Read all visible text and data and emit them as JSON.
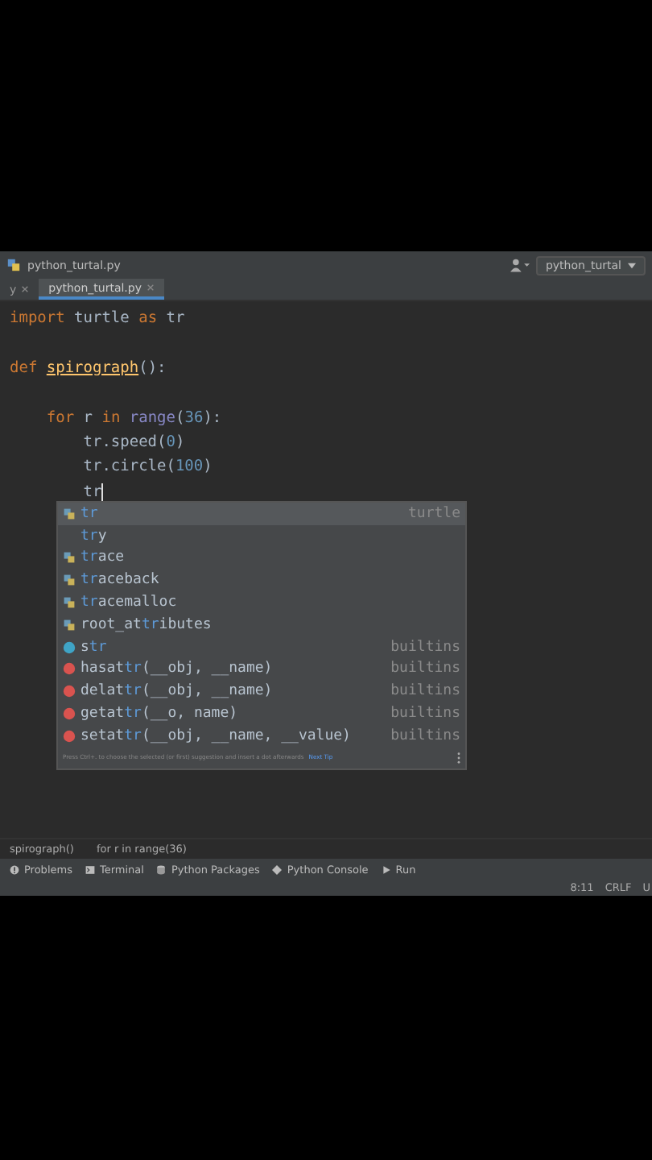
{
  "title_bar": {
    "file": "python_turtal.py",
    "run_config": "python_turtal"
  },
  "tabs": [
    {
      "label": "y",
      "selected": false
    },
    {
      "label": "python_turtal.py",
      "selected": true
    }
  ],
  "code_lines": [
    {
      "kind": "code",
      "tokens": [
        {
          "kind": "keyword",
          "text": "import"
        },
        {
          "kind": "plain",
          "text": " turtle "
        },
        {
          "kind": "keyword",
          "text": "as"
        },
        {
          "kind": "plain",
          "text": " tr"
        }
      ]
    },
    {
      "kind": "blank"
    },
    {
      "kind": "code",
      "tokens": [
        {
          "kind": "keyword",
          "text": "def "
        },
        {
          "kind": "func",
          "text": "spirograph"
        },
        {
          "kind": "plain",
          "text": "():"
        }
      ]
    },
    {
      "kind": "blank"
    },
    {
      "kind": "code",
      "tokens": [
        {
          "kind": "keyword",
          "text": "    for"
        },
        {
          "kind": "plain",
          "text": " r "
        },
        {
          "kind": "keyword",
          "text": "in "
        },
        {
          "kind": "builtin",
          "text": "range"
        },
        {
          "kind": "plain",
          "text": "("
        },
        {
          "kind": "number",
          "text": "36"
        },
        {
          "kind": "plain",
          "text": "):"
        }
      ]
    },
    {
      "kind": "code",
      "tokens": [
        {
          "kind": "plain",
          "text": "        tr.speed("
        },
        {
          "kind": "number",
          "text": "0"
        },
        {
          "kind": "plain",
          "text": ")"
        }
      ]
    },
    {
      "kind": "code",
      "tokens": [
        {
          "kind": "plain",
          "text": "        tr.circle("
        },
        {
          "kind": "number",
          "text": "100"
        },
        {
          "kind": "plain",
          "text": ")"
        }
      ]
    },
    {
      "kind": "code",
      "tokens": [
        {
          "kind": "plain",
          "text": "        tr"
        }
      ],
      "caret": true
    }
  ],
  "completion": {
    "items": [
      {
        "kind": "module",
        "match": "tr",
        "source": "turtle",
        "selected": true
      },
      {
        "kind": "keyword",
        "match": "tr",
        "after": "y",
        "selected": false
      },
      {
        "kind": "module",
        "match": "tr",
        "after": "ace",
        "selected": false
      },
      {
        "kind": "module",
        "match": "tr",
        "after": "aceback",
        "selected": false
      },
      {
        "kind": "module",
        "match": "tr",
        "after": "acemalloc",
        "selected": false
      },
      {
        "kind": "module",
        "before": "root_at",
        "match": "tr",
        "after": "ibutes",
        "selected": false
      },
      {
        "kind": "class",
        "before": "s",
        "match": "tr",
        "source": "builtins",
        "selected": false
      },
      {
        "kind": "function",
        "before": "hasat",
        "match": "tr",
        "after": "(__obj, __name)",
        "source": "builtins",
        "selected": false
      },
      {
        "kind": "function",
        "before": "delat",
        "match": "tr",
        "after": "(__obj, __name)",
        "source": "builtins",
        "selected": false
      },
      {
        "kind": "function",
        "before": "getat",
        "match": "tr",
        "after": "(__o, name)",
        "source": "builtins",
        "selected": false
      },
      {
        "kind": "function",
        "before": "setat",
        "match": "tr",
        "after": "(__obj, __name, __value)",
        "source": "builtins",
        "selected": false
      }
    ],
    "tip": "Press Ctrl+. to choose the selected (or first) suggestion and insert a dot afterwards",
    "tip_link": "Next Tip"
  },
  "breadcrumbs": [
    "spirograph()",
    "for r in range(36)"
  ],
  "tool_windows": [
    {
      "label": "Problems",
      "kind": "problems"
    },
    {
      "label": "Terminal",
      "kind": "terminal"
    },
    {
      "label": "Python Packages",
      "kind": "packages"
    },
    {
      "label": "Python Console",
      "kind": "console"
    },
    {
      "label": "Run",
      "kind": "run"
    }
  ],
  "status": [
    "8:11",
    "CRLF",
    "U"
  ]
}
